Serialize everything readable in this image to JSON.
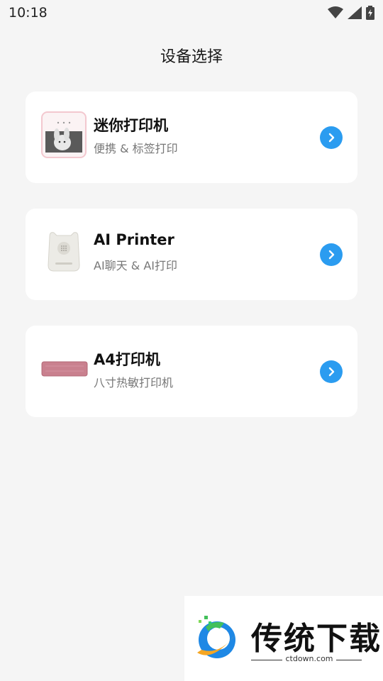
{
  "status_bar": {
    "time": "10:18",
    "icons": [
      "wifi-icon",
      "cell-signal-icon",
      "battery-charging-icon"
    ]
  },
  "page": {
    "title": "设备选择"
  },
  "devices": [
    {
      "title": "迷你打印机",
      "subtitle": "便携 & 标签打印",
      "thumb": "mini-printer-image"
    },
    {
      "title": "AI Printer",
      "subtitle": "AI聊天 & AI打印",
      "thumb": "ai-printer-image"
    },
    {
      "title": "A4打印机",
      "subtitle": "八寸热敏打印机",
      "thumb": "a4-printer-image"
    }
  ],
  "watermark": {
    "name": "传统下载",
    "url": "ctdown.com"
  },
  "colors": {
    "accent": "#2b9cf0",
    "background": "#f5f5f5",
    "card": "#ffffff"
  }
}
